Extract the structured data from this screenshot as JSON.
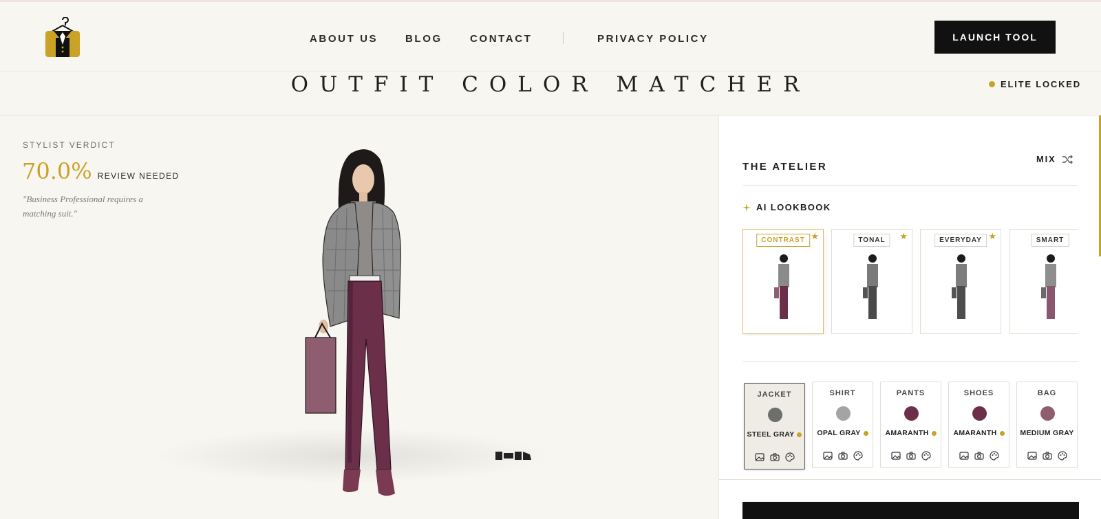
{
  "nav": {
    "links": [
      "ABOUT US",
      "BLOG",
      "CONTACT",
      "PRIVACY POLICY"
    ],
    "launch_label": "LAUNCH TOOL",
    "logo_icon": "hanger-suit-logo-icon"
  },
  "title": {
    "text": "OUTFIT COLOR MATCHER",
    "elite_label": "ELITE LOCKED"
  },
  "verdict": {
    "label": "STYLIST VERDICT",
    "score": "70.0%",
    "status": "REVIEW NEEDED",
    "quote": "\"Business Professional requires a matching suit.\""
  },
  "atelier": {
    "title": "THE ATELIER",
    "mix_label": "MIX",
    "mix_icon": "shuffle-icon",
    "lookbook_label": "AI LOOKBOOK",
    "lookbook_icon": "sparkle-icon",
    "looks": [
      {
        "tag": "CONTRAST",
        "starred": true,
        "active": true,
        "pants": "#6b2f4a",
        "jacket": "#8a8a8a"
      },
      {
        "tag": "TONAL",
        "starred": true,
        "active": false,
        "pants": "#4a4a4a",
        "jacket": "#7a7a7a"
      },
      {
        "tag": "EVERYDAY",
        "starred": true,
        "active": false,
        "pants": "#4d4d4d",
        "jacket": "#7d7d7d"
      },
      {
        "tag": "SMART",
        "starred": false,
        "active": false,
        "pants": "#8a5670",
        "jacket": "#8e8e8e"
      }
    ]
  },
  "slots": [
    {
      "label": "JACKET",
      "color_name": "STEEL GRAY",
      "swatch": "#6e6e6e",
      "active": true
    },
    {
      "label": "SHIRT",
      "color_name": "OPAL GRAY",
      "swatch": "#a5a3a3",
      "active": false
    },
    {
      "label": "PANTS",
      "color_name": "AMARANTH",
      "swatch": "#6b2f4a",
      "active": false
    },
    {
      "label": "SHOES",
      "color_name": "AMARANTH",
      "swatch": "#6b2f4a",
      "active": false
    },
    {
      "label": "BAG",
      "color_name": "MEDIUM GRAY",
      "swatch": "#8e5e70",
      "active": false
    }
  ],
  "slot_icon_names": [
    "image-icon",
    "camera-icon",
    "palette-icon"
  ],
  "colors": {
    "accent_gold": "#c9a227",
    "dark": "#111111",
    "background": "#f8f6f1"
  }
}
